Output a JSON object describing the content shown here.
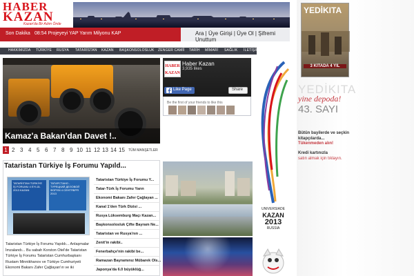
{
  "header": {
    "logo_line1": "HABER",
    "logo_line2": "KAZAN",
    "logo_tagline": "Kazan'da Bir Adım Önde"
  },
  "breaking": {
    "label": "Son Dakika",
    "text": "08:54 Projeyeyi YAP Yarım Milyonu KAP"
  },
  "auth": {
    "links": "Ara | Üye Girişi | Üye Ol | Şifremi Unuttum"
  },
  "nav": {
    "items": [
      "HAKKIMIZDA",
      "TÜRKİYE",
      "RUSYA",
      "TATARİSTAN",
      "KAZAN",
      "BAŞKONSOLOSLUK",
      "ZENGER CAMİİ",
      "TARİH",
      "MİMARİ",
      "SAĞLIK",
      "İLETİŞİM"
    ]
  },
  "slider": {
    "title": "Kamaz'a Bakan'dan Davet !..",
    "pages": [
      "1",
      "2",
      "3",
      "4",
      "5",
      "6",
      "7",
      "8",
      "9",
      "10",
      "11",
      "12",
      "13",
      "14",
      "15"
    ],
    "active_page": "1",
    "all_label": "TÜM MANŞETLER"
  },
  "facebook": {
    "page_name": "Haber Kazan",
    "likes": "3,935 likes",
    "like_label": "Like Page",
    "share_label": "Share",
    "friends_text": "Be the first of your friends to like this",
    "logo_line1": "HABER",
    "logo_line2": "KAZAN"
  },
  "universiade": {
    "label": "UNIVERSIADE",
    "line1": "KAZAN",
    "line2": "2013",
    "line3": "RUSSIA"
  },
  "ad": {
    "magazine_title": "YEDİKITA",
    "cover_sub": "3 KITADA 4 YIL",
    "brand": "YEDİKITA",
    "slogan": "yine depoda!",
    "issue": "43. SAYI",
    "line1": "Bütün bayilerde ve seçkin kitapçılarda...",
    "line2": "Tükenmeden alın!",
    "line3": "Kredi kartınızla",
    "line4": "satın almak için tıklayın."
  },
  "story": {
    "title": "Tataristan Türkiye İş Forumu Yapıld...",
    "image_text_left": "TATARİSTAN TÜRKİYE İŞ FORUMU 4 EYLÜL 2013 KAZAN",
    "image_text_right": "ТАТАРСТАНО - ТУРЕЦКИЙ ДЕЛОВОЙ ФОРУМ 4 СЕНТЯБРЯ 2013",
    "text": "Tataristan Türkiye İş Forumu Yapıldı... Anlaşmalar İmzalandı... Bu sabah Korston Otel'de Tataristan Türkiye İş Forumu Tataristan Cumhurbaşkanı Rustam Minnikhanov ve Türkiye Cumhuriyeti Ekonomi Bakanı Zafer Çağlayan'ın ve iki"
  },
  "links": [
    "Tataristan Türkiye İş Forumu Y...",
    "Tatar-Türk İş Forumu Yarın",
    "Ekonomi Bakanı Zafer Çağlayan ...",
    "Kanal 1'den Türk Dizisi ...",
    "Rusya Lüksemburg Maçı Kazan...",
    "Başkonsolosluk Çifte Bayram Ne...",
    "Tataristan ve Rusya'nın ...",
    "Zenit'in rakibi..",
    "Fenerbahçe'nin rakibi be...",
    "Ramazan Bayramınız Mübarek Ols...",
    "Japonya'da 6.0 büyüklüğ..."
  ],
  "colors": {
    "brand_red": "#c01e26",
    "nav_bg": "#3c3f48",
    "fb_blue": "#4267b2"
  }
}
